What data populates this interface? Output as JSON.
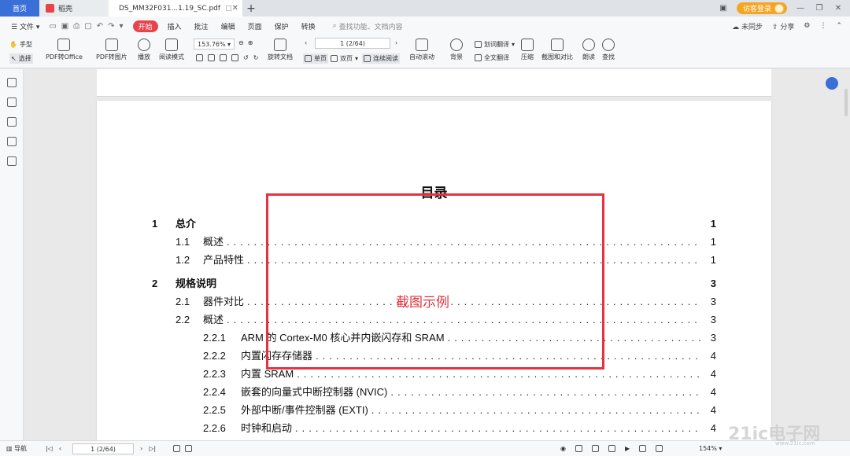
{
  "tabs": [
    {
      "label": "首页"
    },
    {
      "label": "稻壳"
    },
    {
      "label": "DS_MM32F031...1.19_SC.pdf"
    }
  ],
  "window": {
    "login_label": "访客登录"
  },
  "menubar": {
    "file_label": "文件",
    "items": [
      "开始",
      "插入",
      "批注",
      "编辑",
      "页面",
      "保护",
      "转换"
    ],
    "search_placeholder": "查找功能、文档内容",
    "right": [
      "未同步",
      "分享"
    ]
  },
  "toolbar": {
    "hand": "手型",
    "select": "选择",
    "pdf_to_office": "PDF转Office",
    "pdf_to_image": "PDF转图片",
    "play": "播放",
    "read_mode": "阅读模式",
    "zoom_value": "153.76%",
    "page_value": "1 (2/64)",
    "rotate": "旋转文档",
    "single": "单页",
    "double": "双页",
    "continuous": "连续阅读",
    "auto_scroll": "自动滚动",
    "background": "背景",
    "word_translate": "划词翻译",
    "full_translate": "全文翻译",
    "compress": "压缩",
    "screenshot_compare": "截图和对比",
    "read_aloud": "朗读",
    "find": "查找"
  },
  "document": {
    "toc_title": "目录",
    "rows": [
      {
        "level": 1,
        "num": "1",
        "text": "总介",
        "page": "1"
      },
      {
        "level": 2,
        "num": "1.1",
        "text": "概述",
        "page": "1"
      },
      {
        "level": 2,
        "num": "1.2",
        "text": "产品特性",
        "page": "1"
      },
      {
        "level": 1,
        "num": "2",
        "text": "规格说明",
        "page": "3"
      },
      {
        "level": 2,
        "num": "2.1",
        "text": "器件对比",
        "page": "3"
      },
      {
        "level": 2,
        "num": "2.2",
        "text": "概述",
        "page": "3"
      },
      {
        "level": 3,
        "num": "2.2.1",
        "text": "ARM 的 Cortex-M0 核心并内嵌闪存和 SRAM",
        "page": "3"
      },
      {
        "level": 3,
        "num": "2.2.2",
        "text": "内置闪存存储器",
        "page": "4"
      },
      {
        "level": 3,
        "num": "2.2.3",
        "text": "内置 SRAM",
        "page": "4"
      },
      {
        "level": 3,
        "num": "2.2.4",
        "text": "嵌套的向量式中断控制器 (NVIC)",
        "page": "4"
      },
      {
        "level": 3,
        "num": "2.2.5",
        "text": "外部中断/事件控制器 (EXTI)",
        "page": "4"
      },
      {
        "level": 3,
        "num": "2.2.6",
        "text": "时钟和启动",
        "page": "4"
      }
    ],
    "annotation_label": "截图示例",
    "annotation_color": "#e4323e"
  },
  "statusbar": {
    "nav_label": "导航",
    "page_value": "1 (2/64)",
    "zoom_value": "154%"
  },
  "watermark": {
    "text": "21ic电子网",
    "sub": "www.21ic.com"
  }
}
